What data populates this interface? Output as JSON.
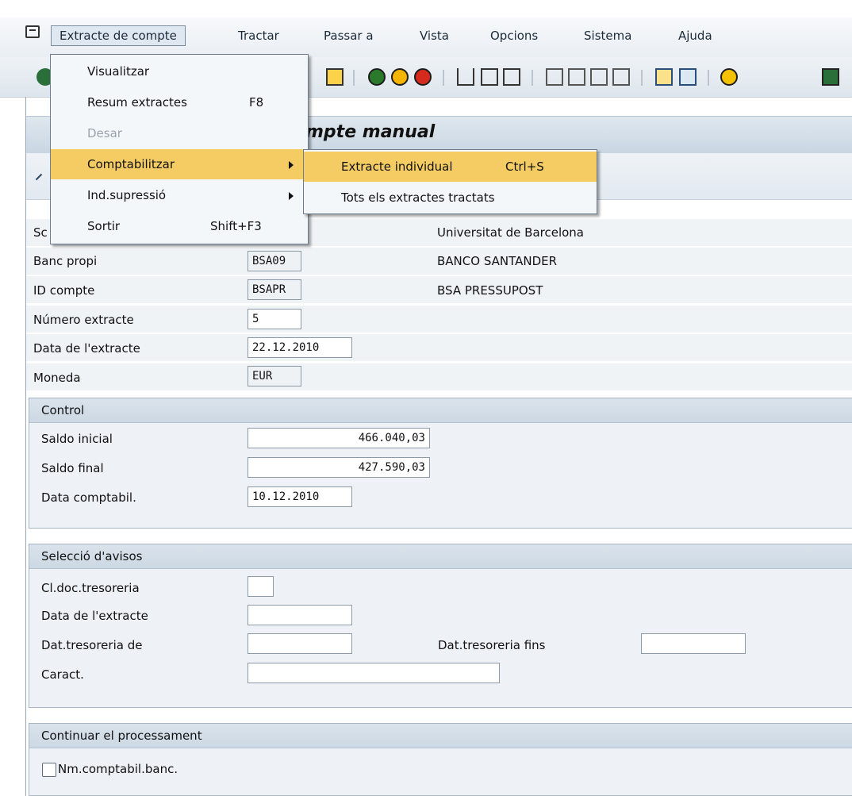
{
  "menubar": {
    "items": [
      "Extracte de compte",
      "Tractar",
      "Passar a",
      "Vista",
      "Opcions",
      "Sistema",
      "Ajuda"
    ]
  },
  "title": "mpte manual",
  "fields": {
    "societat": {
      "label": "Sc",
      "value": ""
    },
    "banc_propi": {
      "label": "Banc propi",
      "value": "BSA09",
      "desc": "BANCO SANTANDER"
    },
    "id_compte": {
      "label": "ID compte",
      "value": "BSAPR",
      "desc": "BSA PRESSUPOST"
    },
    "numero_extracte": {
      "label": "Número extracte",
      "value": "5"
    },
    "data_extracte": {
      "label": "Data de l'extracte",
      "value": "22.12.2010"
    },
    "moneda": {
      "label": "Moneda",
      "value": "EUR"
    },
    "societat_desc": "Universitat de Barcelona"
  },
  "control": {
    "title": "Control",
    "saldo_inicial": {
      "label": "Saldo inicial",
      "value": "466.040,03"
    },
    "saldo_final": {
      "label": "Saldo final",
      "value": "427.590,03"
    },
    "data_comptabil": {
      "label": "Data comptabil.",
      "value": "10.12.2010"
    }
  },
  "seleccio": {
    "title": "Selecció d'avisos",
    "cl_doc": {
      "label": "Cl.doc.tresoreria",
      "value": ""
    },
    "data_extracte": {
      "label": "Data de l'extracte",
      "value": ""
    },
    "dat_tres_de": {
      "label": "Dat.tresoreria de",
      "value": ""
    },
    "dat_tres_fins": {
      "label": "Dat.tresoreria fins",
      "value": ""
    },
    "caract": {
      "label": "Caract.",
      "value": ""
    }
  },
  "continuar": {
    "title": "Continuar el processament",
    "checkbox_label": "Nm.comptabil.banc."
  },
  "menu": {
    "items": [
      {
        "label": "Visualitzar",
        "shortcut": ""
      },
      {
        "label": "Resum extractes",
        "shortcut": "F8"
      },
      {
        "label": "Desar",
        "shortcut": ""
      },
      {
        "label": "Comptabilitzar",
        "shortcut": ""
      },
      {
        "label": "Ind.supressió",
        "shortcut": ""
      },
      {
        "label": "Sortir",
        "shortcut": "Shift+F3"
      }
    ]
  },
  "submenu": {
    "items": [
      {
        "label": "Extracte individual",
        "shortcut": "Ctrl+S"
      },
      {
        "label": "Tots els extractes tractats",
        "shortcut": ""
      }
    ]
  },
  "colors": {
    "highlight": "#f4cc63",
    "accent": "#2a6e3a"
  }
}
